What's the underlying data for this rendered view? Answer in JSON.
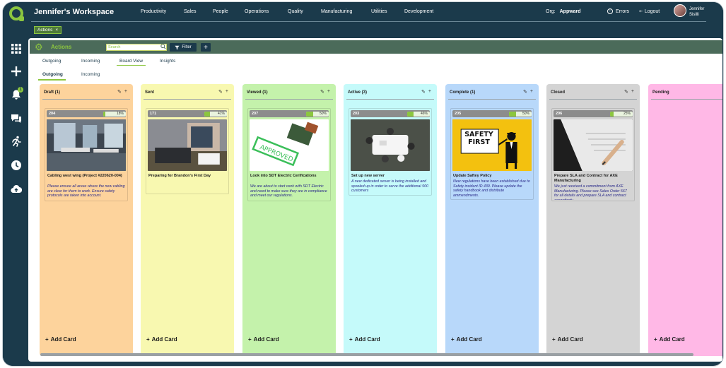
{
  "workspace_title": "Jennifer's Workspace",
  "nav": [
    "Productivity",
    "Sales",
    "People",
    "Operations",
    "Quality",
    "Manufacturing",
    "Utilities",
    "Development"
  ],
  "org_label": "Org:",
  "org_value": "Appward",
  "errors_label": "Errors",
  "logout_label": "Logout",
  "user_first": "Jennifer",
  "user_last": "Sisilli",
  "chip_label": "Actions",
  "chip_close": "×",
  "panel_title": "Actions",
  "search_placeholder": "Search",
  "filter_label": "Filter",
  "plus_label": "+",
  "tabs": [
    "Outgoing",
    "Incoming",
    "Board View",
    "Insights"
  ],
  "subtabs": [
    "Outgoing",
    "Incoming"
  ],
  "add_card_label": "Add Card",
  "columns": [
    {
      "title": "Draft (1)",
      "color": "#fdd39c",
      "card": {
        "id": "204",
        "progress": "18%",
        "pct": 18,
        "title": "Cabling west wing (Project #220620-004)",
        "desc": "Please ensure all areas where the new cabling are clear for them to work. Ensure safety protocols are taken into account.",
        "image": "office"
      }
    },
    {
      "title": "Sent",
      "color": "#f8f8b0",
      "card": {
        "id": "171",
        "progress": "41%",
        "pct": 41,
        "title": "Preparing for Brandon's First Day",
        "desc": "",
        "image": "laptop"
      }
    },
    {
      "title": "Viewed (1)",
      "color": "#c4f2ab",
      "card": {
        "id": "207",
        "progress": "50%",
        "pct": 50,
        "title": "Look into SDT Electric Cerifications",
        "desc": "We are about to start work with SDT Electric and need to make sure they are in compliance and meet our regulations.",
        "image": "stamp"
      }
    },
    {
      "title": "Active (3)",
      "color": "#c5fafa",
      "card": {
        "id": "203",
        "progress": "46%",
        "pct": 46,
        "title": "Set up new server",
        "desc": "A new dedicated server is being installed and spooled up in order to serve the additional 500 customers",
        "image": "meeting"
      }
    },
    {
      "title": "Complete (1)",
      "color": "#b8d8fa",
      "card": {
        "id": "205",
        "progress": "50%",
        "pct": 50,
        "title": "Update Saftey Policy",
        "desc": "New regulations have been established due to Safety incident ID 439. Please update the safety handbook and distribute ammendments.",
        "image": "safety",
        "image_text_1": "SAFETY",
        "image_text_2": "FIRST"
      }
    },
    {
      "title": "Closed",
      "color": "#d4d4d4",
      "card": {
        "id": "206",
        "progress": "25%",
        "pct": 25,
        "title": "Prepare SLA and Contract for AXE Manufacturing",
        "desc": "We just received a commitment from AXE Manufacturing. Please see Sales Order 567 for all details and prepare SLA and contract accordingly.",
        "image": "contract"
      }
    },
    {
      "title": "Pending",
      "color": "#ffb8e6",
      "card": null
    }
  ]
}
